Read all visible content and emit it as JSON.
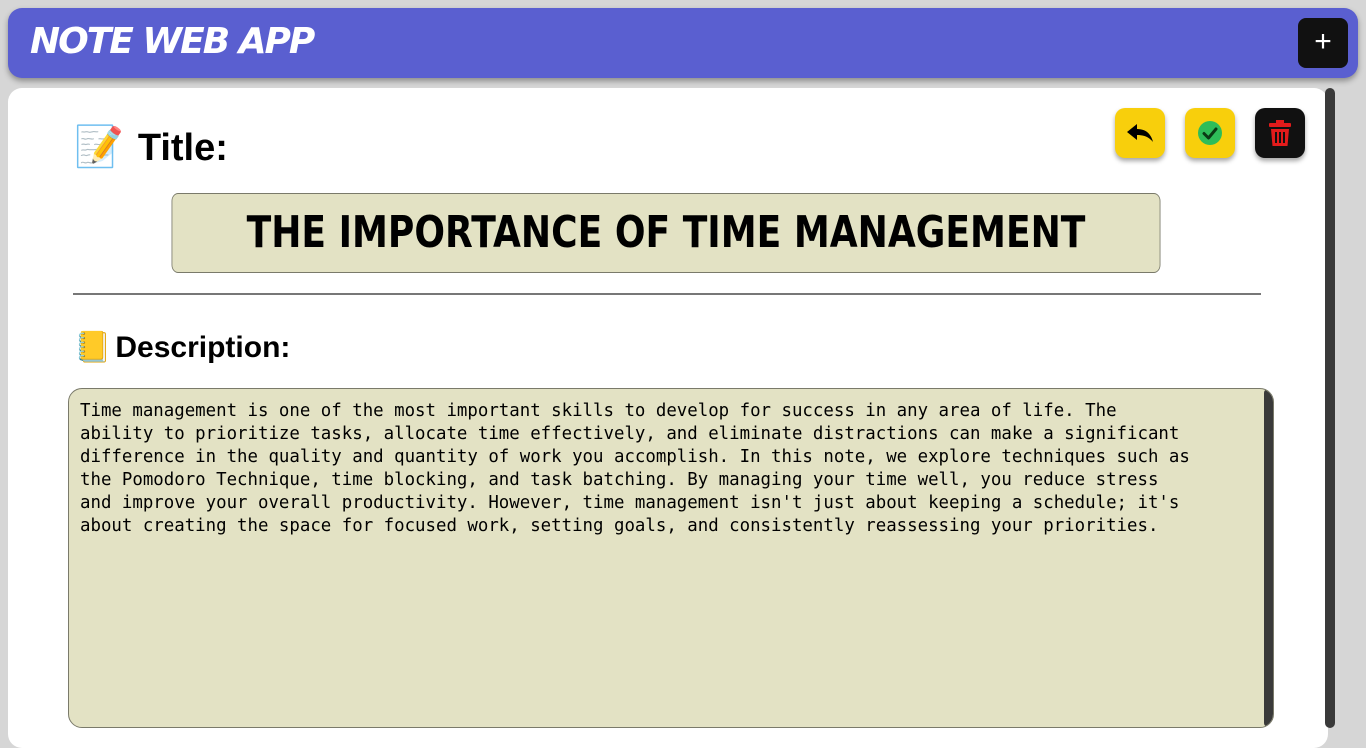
{
  "header": {
    "app_title": "NOTE WEB APP",
    "add_label": "+"
  },
  "note": {
    "title_label": "Title:",
    "title_emoji": "📝",
    "title_value": "THE IMPORTANCE OF TIME MANAGEMENT",
    "description_label": "Description:",
    "description_emoji": "📒",
    "description_value": "Time management is one of the most important skills to develop for success in any area of life. The\nability to prioritize tasks, allocate time effectively, and eliminate distractions can make a significant\ndifference in the quality and quantity of work you accomplish. In this note, we explore techniques such as\nthe Pomodoro Technique, time blocking, and task batching. By managing your time well, you reduce stress\nand improve your overall productivity. However, time management isn't just about keeping a schedule; it's\nabout creating the space for focused work, setting goals, and consistently reassessing your priorities."
  },
  "actions": {
    "back_icon": "reply-arrow-icon",
    "save_icon": "check-circle-icon",
    "delete_icon": "trash-icon"
  },
  "colors": {
    "header_bg": "#5a5fd0",
    "action_yellow": "#f8cf0c",
    "field_bg": "#e3e2c4",
    "save_green": "#2ebd59",
    "delete_red": "#e21b1b"
  }
}
